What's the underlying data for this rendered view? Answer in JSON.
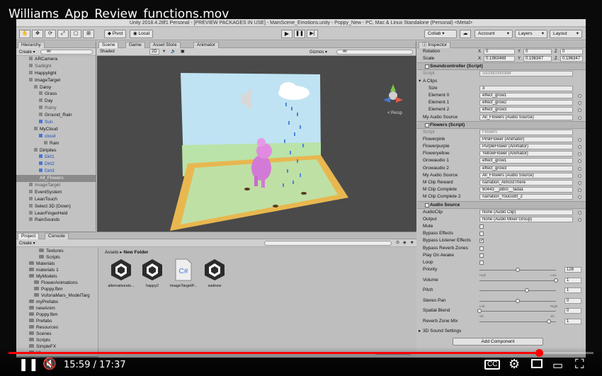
{
  "video": {
    "title": "Williams_App_Review_functions.mov",
    "time_current": "15:59",
    "time_separator": "/",
    "time_total": "17:37",
    "progress": 0.907
  },
  "unity": {
    "window_title": "Unity 2018.4.28f1 Personal - [PREVIEW PACKAGES IN USE] - MainScene_Emotions.unity - Poppy_New - PC, Mac & Linux Standalone (Personal) <Metal>",
    "toolbar": {
      "pivot": "Pivot",
      "local": "Local",
      "collab": "Collab ▾",
      "account": "Account",
      "layers": "Layers",
      "layout": "Layout"
    },
    "hierarchy": {
      "tab": "Hierarchy",
      "create": "Create ▾",
      "search_placeholder": "All",
      "items": [
        {
          "label": "MainScene_Emotions*",
          "indent": 0,
          "style": "scene"
        },
        {
          "label": "ARCamera",
          "indent": 2,
          "style": ""
        },
        {
          "label": "Sadlight",
          "indent": 2,
          "style": "gray"
        },
        {
          "label": "Happylight",
          "indent": 2,
          "style": ""
        },
        {
          "label": "ImageTarget",
          "indent": 2,
          "style": ""
        },
        {
          "label": "Daisy",
          "indent": 3,
          "style": ""
        },
        {
          "label": "Grass",
          "indent": 4,
          "style": ""
        },
        {
          "label": "Day",
          "indent": 4,
          "style": ""
        },
        {
          "label": "Rainy",
          "indent": 4,
          "style": "gray"
        },
        {
          "label": "Ground_Rain",
          "indent": 4,
          "style": ""
        },
        {
          "label": "Sun",
          "indent": 4,
          "style": "blue"
        },
        {
          "label": "MyCloud",
          "indent": 3,
          "style": ""
        },
        {
          "label": "cloud",
          "indent": 4,
          "style": "blue"
        },
        {
          "label": "Rain",
          "indent": 5,
          "style": ""
        },
        {
          "label": "Dirtpiles",
          "indent": 3,
          "style": ""
        },
        {
          "label": "Dirt1",
          "indent": 4,
          "style": "blue"
        },
        {
          "label": "Dirt2",
          "indent": 4,
          "style": "blue"
        },
        {
          "label": "Dirt3",
          "indent": 4,
          "style": "blue"
        },
        {
          "label": "All_Flowers",
          "indent": 3,
          "style": "sel"
        },
        {
          "label": "ImageTarget",
          "indent": 2,
          "style": "gray"
        },
        {
          "label": "EventSystem",
          "indent": 2,
          "style": ""
        },
        {
          "label": "LeanTouch",
          "indent": 2,
          "style": ""
        },
        {
          "label": "Select 3D (Down)",
          "indent": 2,
          "style": ""
        },
        {
          "label": "LeanFingerHeld",
          "indent": 2,
          "style": ""
        },
        {
          "label": "RainSounds",
          "indent": 2,
          "style": ""
        }
      ]
    },
    "scene": {
      "tabs": [
        "Scene",
        "Game",
        "Asset Store",
        "Animator"
      ],
      "shading": "Shaded",
      "mode_2d": "2D",
      "gizmos": "Gizmos ▾",
      "search_placeholder": "All",
      "persp": "< Persp"
    },
    "inspector": {
      "tab": "Inspector",
      "rotation": {
        "label": "Rotation",
        "x": "0",
        "y": "0",
        "z": "0"
      },
      "scale": {
        "label": "Scale",
        "x": "0.1963469",
        "y": "0.196347",
        "z": "0.196347"
      },
      "soundcontroller": {
        "title": "Soundcontroller (Script)",
        "script_label": "Script",
        "script_value": "soundcontroller",
        "clips_label": "A Clips",
        "size_label": "Size",
        "size_value": "3",
        "elements": [
          {
            "label": "Element 0",
            "value": "effect_grow1"
          },
          {
            "label": "Element 1",
            "value": "effect_grow2"
          },
          {
            "label": "Element 2",
            "value": "effect_grow3"
          }
        ],
        "audio_source_label": "My Audio Source",
        "audio_source_value": "All_Flowers (Audio Source)"
      },
      "flowers": {
        "title": "Flowers (Script)",
        "rows": [
          {
            "label": "Script",
            "value": "Flowers"
          },
          {
            "label": "Flowerpink",
            "value": "PinkFlower (Animator)"
          },
          {
            "label": "Flowerpurple",
            "value": "PurpleFlower (Animator)"
          },
          {
            "label": "Floweryellow",
            "value": "YellowFlower (Animator)"
          },
          {
            "label": "Growaudio 1",
            "value": "effect_grow1"
          },
          {
            "label": "Growaudio 2",
            "value": "effect_grow3"
          },
          {
            "label": "My Audio Source",
            "value": "All_Flowers (Audio Source)"
          },
          {
            "label": "M Clip Reward",
            "value": "narration_AlmostThere"
          },
          {
            "label": "M Clip Complete",
            "value": "60443__jobro__tada1"
          },
          {
            "label": "M Clip Complete 2",
            "value": "narration_YouGotIt_2"
          }
        ]
      },
      "audio_source": {
        "title": "Audio Source",
        "audioclip_label": "AudioClip",
        "audioclip_value": "None (Audio Clip)",
        "output_label": "Output",
        "output_value": "None (Audio Mixer Group)",
        "checks": [
          {
            "label": "Mute",
            "checked": false
          },
          {
            "label": "Bypass Effects",
            "checked": false
          },
          {
            "label": "Bypass Listener Effects",
            "checked": true
          },
          {
            "label": "Bypass Reverb Zones",
            "checked": false
          },
          {
            "label": "Play On Awake",
            "checked": false
          },
          {
            "label": "Loop",
            "checked": false
          }
        ],
        "sliders": [
          {
            "label": "Priority",
            "value": "128",
            "pos": 0.5,
            "left_hint": "High",
            "right_hint": "Low"
          },
          {
            "label": "Volume",
            "value": "1",
            "pos": 1.0,
            "left_hint": "",
            "right_hint": ""
          },
          {
            "label": "Pitch",
            "value": "1",
            "pos": 0.62,
            "left_hint": "",
            "right_hint": ""
          },
          {
            "label": "Stereo Pan",
            "value": "0",
            "pos": 0.5,
            "left_hint": "Left",
            "right_hint": "Right"
          },
          {
            "label": "Spatial Blend",
            "value": "0",
            "pos": 0.0,
            "left_hint": "2D",
            "right_hint": "3D"
          },
          {
            "label": "Reverb Zone Mix",
            "value": "1",
            "pos": 0.91,
            "left_hint": "",
            "right_hint": ""
          }
        ],
        "sound_settings": "3D Sound Settings"
      },
      "add_component": "Add Component"
    },
    "project": {
      "tabs": [
        "Project",
        "Console"
      ],
      "create": "Create ▾",
      "breadcrumb_root": "Assets",
      "breadcrumb_sep": "▸",
      "breadcrumb_folder": "New Folder",
      "tree": [
        {
          "label": "Textures",
          "indent": 4
        },
        {
          "label": "Scripts",
          "indent": 4
        },
        {
          "label": "Materials",
          "indent": 2
        },
        {
          "label": "materials 1",
          "indent": 2
        },
        {
          "label": "MyModels",
          "indent": 2
        },
        {
          "label": "FlowerAnimations",
          "indent": 3
        },
        {
          "label": "Poppy.fbm",
          "indent": 3
        },
        {
          "label": "VuforiaMars_ModelTarg",
          "indent": 3
        },
        {
          "label": "myPrefabs",
          "indent": 2
        },
        {
          "label": "newAnim",
          "indent": 2
        },
        {
          "label": "Poppy.fbm",
          "indent": 2
        },
        {
          "label": "Prefabs",
          "indent": 2
        },
        {
          "label": "Resources",
          "indent": 2
        },
        {
          "label": "Scenes",
          "indent": 2
        },
        {
          "label": "Scripts",
          "indent": 2
        },
        {
          "label": "SimpleFX",
          "indent": 2
        },
        {
          "label": "UI",
          "indent": 2
        },
        {
          "label": "New Folder",
          "indent": 2
        }
      ],
      "assets": [
        {
          "label": "alternativesto...",
          "kind": "unity"
        },
        {
          "label": "happy2",
          "kind": "unity"
        },
        {
          "label": "ImageTargetP...",
          "kind": "cs"
        },
        {
          "label": "sadnew",
          "kind": "unity"
        }
      ]
    }
  },
  "colors": {
    "progress": "#ff0000",
    "unity_bg": "#c2c2c2",
    "selection": "#8a8a8a",
    "prefab_blue": "#1d4fb8"
  }
}
